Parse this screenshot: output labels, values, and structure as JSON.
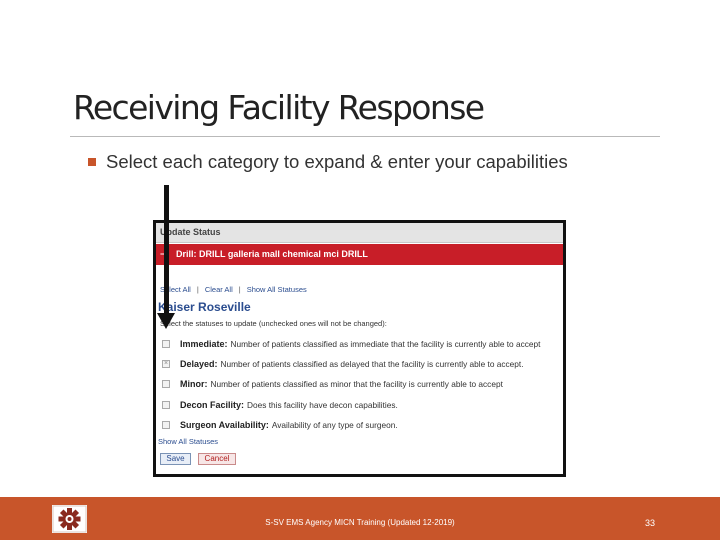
{
  "slide": {
    "title": "Receiving Facility Response",
    "bullet": "Select each category to expand & enter your capabilities"
  },
  "screenshot": {
    "header": "Update Status",
    "drill_toggle": "−",
    "drill_title": "Drill: DRILL galleria mall chemical mci DRILL",
    "links": {
      "select_all": "Select All",
      "clear_all": "Clear All",
      "show_all_statuses": "Show All Statuses",
      "separator": "|"
    },
    "facility": "Kaiser Roseville",
    "instruction": "Select the statuses to update (unchecked ones will not be changed):",
    "checkbox_mark": "×",
    "statuses": [
      {
        "category": "Immediate:",
        "description": "Number of patients classified as immediate that the facility is currently able to accept"
      },
      {
        "category": "Delayed:",
        "description": "Number of patients classified as delayed that the facility is currently able to accept."
      },
      {
        "category": "Minor:",
        "description": "Number of patients classified as minor that the facility is currently able to accept"
      },
      {
        "category": "Decon Facility:",
        "description": "Does this facility have decon capabilities."
      },
      {
        "category": "Surgeon Availability:",
        "description": "Availability of any type of surgeon."
      }
    ],
    "show_all_bottom": "Show All Statuses",
    "save_label": "Save",
    "cancel_label": "Cancel"
  },
  "footer": {
    "text": "S-SV EMS Agency MICN Training (Updated 12-2019)",
    "page_number": "33"
  },
  "colors": {
    "accent": "#c8552a",
    "drill_bar": "#c81e28",
    "link": "#2b4d8f"
  }
}
